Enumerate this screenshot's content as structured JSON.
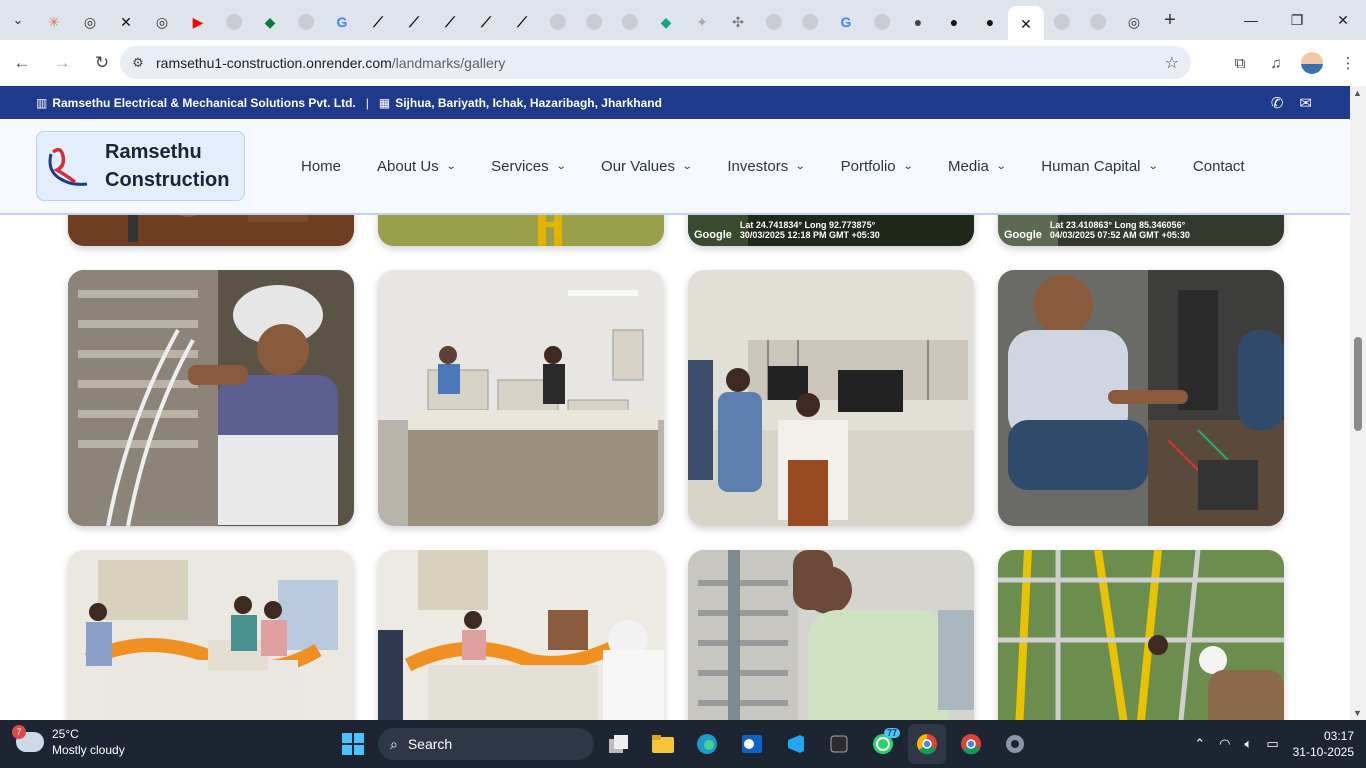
{
  "browser": {
    "omnibox_url_host": "ramsethu1-construction.onrender.com",
    "omnibox_url_path": "/landmarks/gallery",
    "tabs": [
      {
        "icon": "claude-icon",
        "color": "#d97757"
      },
      {
        "icon": "chatgpt-icon",
        "color": "#333333"
      },
      {
        "icon": "x-icon",
        "color": "#111111"
      },
      {
        "icon": "chatgpt-icon",
        "color": "#333333"
      },
      {
        "icon": "youtube-icon",
        "color": "#ff0000"
      },
      {
        "icon": "globe-icon",
        "color": "#c9ccd3"
      },
      {
        "icon": "leaf-icon",
        "color": "#0a7a3e"
      },
      {
        "icon": "globe-icon",
        "color": "#c9ccd3"
      },
      {
        "icon": "google-icon",
        "color": "#4285f4"
      },
      {
        "icon": "link-icon",
        "color": "#111111"
      },
      {
        "icon": "link-icon",
        "color": "#111111"
      },
      {
        "icon": "link-icon",
        "color": "#111111"
      },
      {
        "icon": "link-icon",
        "color": "#111111"
      },
      {
        "icon": "link-icon",
        "color": "#111111"
      },
      {
        "icon": "globe-icon",
        "color": "#c9ccd3"
      },
      {
        "icon": "globe-icon",
        "color": "#c9ccd3"
      },
      {
        "icon": "globe-icon",
        "color": "#c9ccd3"
      },
      {
        "icon": "diamond-icon",
        "color": "#11a58a"
      },
      {
        "icon": "fan-icon",
        "color": "#a9a9a9"
      },
      {
        "icon": "sparkle-icon",
        "color": "#777777"
      },
      {
        "icon": "globe-icon",
        "color": "#c9ccd3"
      },
      {
        "icon": "globe-icon",
        "color": "#c9ccd3"
      },
      {
        "icon": "google-icon",
        "color": "#4285f4"
      },
      {
        "icon": "globe-icon",
        "color": "#c9ccd3"
      },
      {
        "icon": "avatar-icon",
        "color": "#444444"
      },
      {
        "icon": "github-icon",
        "color": "#111111"
      },
      {
        "icon": "github-icon",
        "color": "#111111"
      },
      {
        "icon": "close-icon",
        "color": "#111111",
        "active": true
      },
      {
        "icon": "globe-icon",
        "color": "#c9ccd3"
      },
      {
        "icon": "globe-icon",
        "color": "#c9ccd3"
      },
      {
        "icon": "chatgpt-icon",
        "color": "#333333"
      }
    ]
  },
  "site": {
    "topbar": {
      "company": "Ramsethu Electrical & Mechanical Solutions Pvt. Ltd.",
      "separator": "|",
      "address": "Sijhua, Bariyath, Ichak, Hazaribagh, Jharkhand"
    },
    "brand": {
      "line1": "Ramsethu",
      "line2": "Construction"
    },
    "nav": [
      {
        "label": "Home",
        "dropdown": false
      },
      {
        "label": "About Us",
        "dropdown": true
      },
      {
        "label": "Services",
        "dropdown": true
      },
      {
        "label": "Our Values",
        "dropdown": true
      },
      {
        "label": "Investors",
        "dropdown": true
      },
      {
        "label": "Portfolio",
        "dropdown": true
      },
      {
        "label": "Media",
        "dropdown": true
      },
      {
        "label": "Human Capital",
        "dropdown": true
      },
      {
        "label": "Contact",
        "dropdown": false
      }
    ],
    "colors": {
      "topbar": "#1f3a8a",
      "header_bg": "#f6f9ff",
      "logo_box": "#e3eefc"
    }
  },
  "gallery": {
    "top_row_captions": [
      {
        "google": "Google",
        "line1": "Lat 24.741834° Long 92.773875°",
        "line2": "30/03/2025 12:18 PM GMT +05:30"
      },
      {
        "google": "Google",
        "line1": "Lat 23.410863° Long 85.346056°",
        "line2": "04/03/2025 07:52 AM GMT +05:30"
      }
    ]
  },
  "taskbar": {
    "weather_badge": "7",
    "temperature": "25°C",
    "condition": "Mostly cloudy",
    "search_label": "Search",
    "whatsapp_badge": "77",
    "time": "03:17",
    "date": "31-10-2025"
  }
}
